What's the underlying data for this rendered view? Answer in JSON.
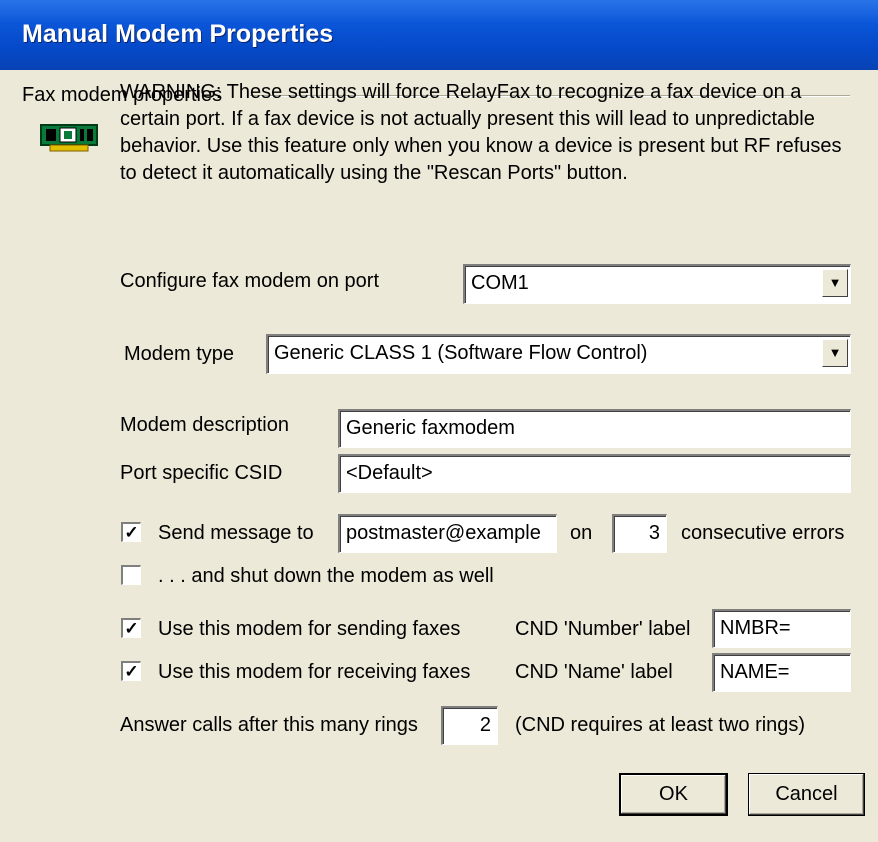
{
  "title": "Manual Modem Properties",
  "group_label": "Fax modem properties",
  "icon": "fax-modem-card-icon",
  "warning": "WARNING:  These settings will force RelayFax to recognize a fax device on a certain port.  If a fax device is not actually present this will lead to unpredictable behavior.  Use this feature only when you know a device is present but RF refuses to detect it automatically using the \"Rescan Ports\" button.",
  "port": {
    "label": "Configure fax modem on port",
    "value": "COM1"
  },
  "modem_type": {
    "label": "Modem type",
    "value": "Generic CLASS 1 (Software Flow Control)"
  },
  "description": {
    "label": "Modem description",
    "value": "Generic faxmodem"
  },
  "csid": {
    "label": "Port specific CSID",
    "value": "<Default>"
  },
  "send_message": {
    "checked": true,
    "label": "Send message to",
    "address": "postmaster@example",
    "on_label": "on",
    "count": "3",
    "suffix": "consecutive errors"
  },
  "shutdown": {
    "checked": false,
    "label": ". . . and shut down the modem as well"
  },
  "use_sending": {
    "checked": true,
    "label": "Use this modem for sending faxes"
  },
  "use_receiving": {
    "checked": true,
    "label": "Use this modem for receiving faxes"
  },
  "cnd_number": {
    "label": "CND 'Number' label",
    "value": "NMBR="
  },
  "cnd_name": {
    "label": "CND 'Name' label",
    "value": "NAME="
  },
  "rings": {
    "label": "Answer calls after this many rings",
    "value": "2",
    "note": "(CND requires at least two rings)"
  },
  "buttons": {
    "ok": "OK",
    "cancel": "Cancel"
  }
}
